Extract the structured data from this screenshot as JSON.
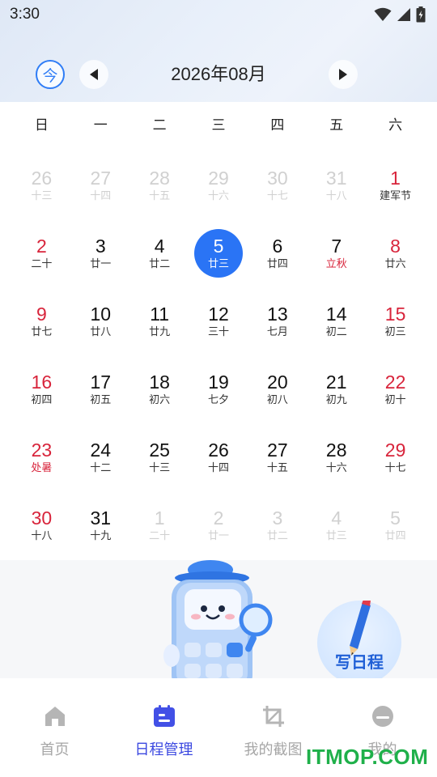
{
  "status_bar": {
    "time": "3:30"
  },
  "header": {
    "today_label": "今",
    "month_title": "2026年08月"
  },
  "weekdays": [
    "日",
    "一",
    "二",
    "三",
    "四",
    "五",
    "六"
  ],
  "calendar": {
    "selected_day": "5",
    "days": [
      {
        "num": "26",
        "lunar": "十三",
        "style": "faded"
      },
      {
        "num": "27",
        "lunar": "十四",
        "style": "faded"
      },
      {
        "num": "28",
        "lunar": "十五",
        "style": "faded"
      },
      {
        "num": "29",
        "lunar": "十六",
        "style": "faded"
      },
      {
        "num": "30",
        "lunar": "十七",
        "style": "faded"
      },
      {
        "num": "31",
        "lunar": "十八",
        "style": "faded"
      },
      {
        "num": "1",
        "lunar": "建军节",
        "style": "red"
      },
      {
        "num": "2",
        "lunar": "二十",
        "style": "red"
      },
      {
        "num": "3",
        "lunar": "廿一",
        "style": "normal"
      },
      {
        "num": "4",
        "lunar": "廿二",
        "style": "normal"
      },
      {
        "num": "5",
        "lunar": "廿三",
        "style": "selected"
      },
      {
        "num": "6",
        "lunar": "廿四",
        "style": "normal"
      },
      {
        "num": "7",
        "lunar": "立秋",
        "style": "fest"
      },
      {
        "num": "8",
        "lunar": "廿六",
        "style": "red"
      },
      {
        "num": "9",
        "lunar": "廿七",
        "style": "red"
      },
      {
        "num": "10",
        "lunar": "廿八",
        "style": "normal"
      },
      {
        "num": "11",
        "lunar": "廿九",
        "style": "normal"
      },
      {
        "num": "12",
        "lunar": "三十",
        "style": "normal"
      },
      {
        "num": "13",
        "lunar": "七月",
        "style": "normal"
      },
      {
        "num": "14",
        "lunar": "初二",
        "style": "normal"
      },
      {
        "num": "15",
        "lunar": "初三",
        "style": "red"
      },
      {
        "num": "16",
        "lunar": "初四",
        "style": "red"
      },
      {
        "num": "17",
        "lunar": "初五",
        "style": "normal"
      },
      {
        "num": "18",
        "lunar": "初六",
        "style": "normal"
      },
      {
        "num": "19",
        "lunar": "七夕",
        "style": "normal"
      },
      {
        "num": "20",
        "lunar": "初八",
        "style": "normal"
      },
      {
        "num": "21",
        "lunar": "初九",
        "style": "normal"
      },
      {
        "num": "22",
        "lunar": "初十",
        "style": "red"
      },
      {
        "num": "23",
        "lunar": "处暑",
        "style": "red-fest"
      },
      {
        "num": "24",
        "lunar": "十二",
        "style": "normal"
      },
      {
        "num": "25",
        "lunar": "十三",
        "style": "normal"
      },
      {
        "num": "26",
        "lunar": "十四",
        "style": "normal"
      },
      {
        "num": "27",
        "lunar": "十五",
        "style": "normal"
      },
      {
        "num": "28",
        "lunar": "十六",
        "style": "normal"
      },
      {
        "num": "29",
        "lunar": "十七",
        "style": "red"
      },
      {
        "num": "30",
        "lunar": "十八",
        "style": "red"
      },
      {
        "num": "31",
        "lunar": "十九",
        "style": "normal"
      },
      {
        "num": "1",
        "lunar": "二十",
        "style": "faded"
      },
      {
        "num": "2",
        "lunar": "廿一",
        "style": "faded"
      },
      {
        "num": "3",
        "lunar": "廿二",
        "style": "faded"
      },
      {
        "num": "4",
        "lunar": "廿三",
        "style": "faded"
      },
      {
        "num": "5",
        "lunar": "廿四",
        "style": "faded"
      }
    ]
  },
  "promo": {
    "write_button_label": "写日程"
  },
  "tabbar": {
    "tabs": [
      {
        "label": "首页",
        "icon": "home-icon",
        "active": false
      },
      {
        "label": "日程管理",
        "icon": "schedule-icon",
        "active": true
      },
      {
        "label": "我的截图",
        "icon": "crop-icon",
        "active": false
      },
      {
        "label": "我的",
        "icon": "profile-icon",
        "active": false
      }
    ]
  },
  "watermark": "ITMOP.COM",
  "colors": {
    "accent": "#2a74f5",
    "red": "#d8243b",
    "tab_active": "#3b48e0",
    "tab_inactive": "#a6a6a6",
    "faded": "#d0d0d0"
  }
}
